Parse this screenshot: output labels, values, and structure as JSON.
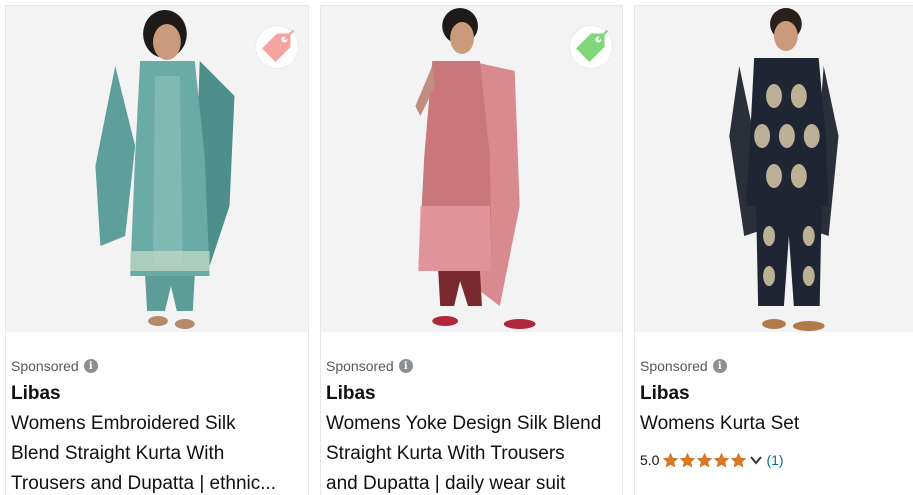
{
  "products": [
    {
      "sponsored_label": "Sponsored",
      "brand": "Libas",
      "title_lines": [
        "Womens Embroidered Silk",
        "Blend Straight Kurta With",
        "Trousers and Dupatta | ethnic..."
      ],
      "tag_icon_color": "#f4a3a0",
      "tag_icon": "price-tag-icon"
    },
    {
      "sponsored_label": "Sponsored",
      "brand": "Libas",
      "title_lines": [
        "Womens Yoke Design Silk Blend",
        "Straight Kurta With Trousers",
        "and Dupatta | daily wear suit"
      ],
      "tag_icon_color": "#7fd77a",
      "tag_icon": "price-tag-icon"
    },
    {
      "sponsored_label": "Sponsored",
      "brand": "Libas",
      "title_lines": [
        "Womens Kurta Set"
      ],
      "rating_value": "5.0",
      "rating_stars": 5,
      "rating_count": "(1)"
    }
  ],
  "colors": {
    "star": "#de7921",
    "link": "#007185",
    "muted": "#565959"
  }
}
